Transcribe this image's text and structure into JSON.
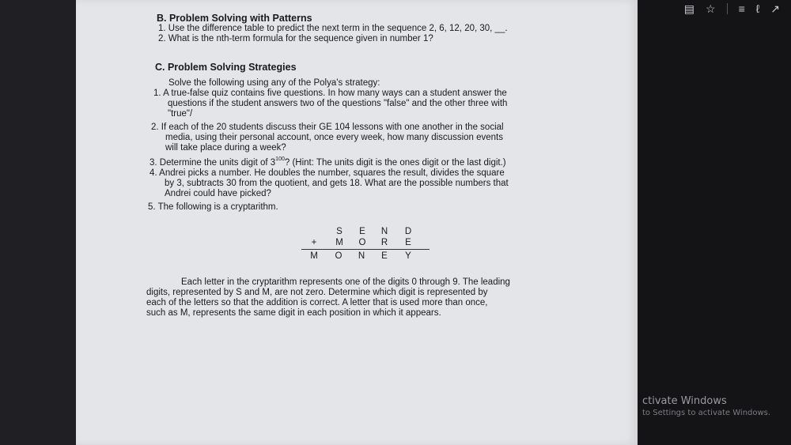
{
  "sectionB": {
    "heading": "B. Problem Solving with Patterns",
    "item1": "1. Use the difference table to predict the next term in the sequence 2, 6, 12, 20, 30, __.",
    "item2": "2. What is the nth-term formula for the sequence given in number 1?"
  },
  "sectionC": {
    "heading": "C. Problem Solving Strategies",
    "intro": "Solve the following using any of the Polya's strategy:",
    "q1_l1": "1. A true-false quiz contains five questions. In how many ways can a student answer the",
    "q1_l2": "questions if the student answers two of the questions \"false\" and the other three with",
    "q1_l3": "\"true\"/",
    "q2_l1": "2. If each of the 20 students discuss their GE 104 lessons with one another in the social",
    "q2_l2": "media, using their personal account, once every week, how many discussion events",
    "q2_l3": "will take place during a week?",
    "q3_pre": "3. Determine the units digit of 3",
    "q3_exp": "100",
    "q3_post": "? (Hint: The units digit is the ones digit or the last digit.)",
    "q4_l1": "4. Andrei picks a number. He doubles the number, squares the result, divides the square",
    "q4_l2": "by 3, subtracts 30 from the quotient, and gets 18. What are the possible numbers that",
    "q4_l3": "Andrei could have picked?",
    "q5": "5. The following is a cryptarithm.",
    "crypt": {
      "row1": [
        "S",
        "E",
        "N",
        "D"
      ],
      "plus": "+",
      "row2": [
        "M",
        "O",
        "R",
        "E"
      ],
      "row3": [
        "M",
        "O",
        "N",
        "E",
        "Y"
      ]
    },
    "p_l1": "Each letter in the cryptarithm represents one of the digits 0 through 9. The leading",
    "p_l2": "digits, represented by S and M, are not zero. Determine which digit is represented by",
    "p_l3": "each of the letters so that the addition is correct. A letter that is used more than once,",
    "p_l4": "such as M, represents the same digit in each position in which it appears."
  },
  "watermark": {
    "line1": "ctivate Windows",
    "line2": "to Settings to activate Windows."
  },
  "toolbar_icons": [
    "reading-view-icon",
    "favorite-star-icon",
    "hub-icon",
    "pen-icon",
    "share-icon"
  ]
}
